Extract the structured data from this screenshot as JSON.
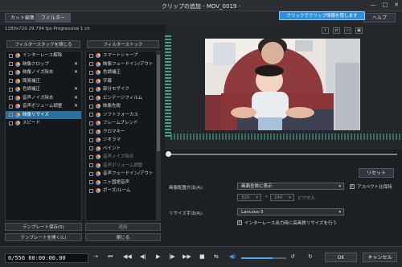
{
  "window": {
    "title": "クリップの追加 - MOV_0019 -",
    "controls": [
      "—",
      "□",
      "✕"
    ]
  },
  "toolbar": {
    "cut_edit": "カット編集",
    "filter": "フィルター",
    "help": "ヘルプ",
    "tooltip": "クリックでクリップ情報を隠します"
  },
  "info": "1280x720 29.794 fps Progressive  1 ch",
  "left": {
    "header_button": "フィルタースタックを閉じる",
    "stack": [
      {
        "label": "インターレース解除",
        "checked": false,
        "removable": false,
        "selected": false
      },
      {
        "label": "映像クロップ",
        "checked": false,
        "removable": true,
        "selected": false
      },
      {
        "label": "映像ノイズ除去",
        "checked": false,
        "removable": true,
        "selected": false
      },
      {
        "label": "簡易補正",
        "checked": false,
        "removable": false,
        "selected": false
      },
      {
        "label": "色調補正",
        "checked": false,
        "removable": true,
        "selected": false
      },
      {
        "label": "音声ノイズ除去",
        "checked": false,
        "removable": true,
        "selected": false
      },
      {
        "label": "音声ボリューム調整",
        "checked": false,
        "removable": true,
        "selected": false
      },
      {
        "label": "映像リサイズ",
        "checked": false,
        "removable": false,
        "selected": true
      },
      {
        "label": "スピード",
        "checked": false,
        "removable": false,
        "selected": false
      }
    ],
    "template_save": "テンプレート保存(S)",
    "template_load": "テンプレートを開く(L)"
  },
  "mid": {
    "header_button": "フィルターストック",
    "items": [
      {
        "label": "スマートシャープ",
        "dim": false
      },
      {
        "label": "映像フェードイン/アウト",
        "dim": false
      },
      {
        "label": "色調補正",
        "dim": false
      },
      {
        "label": "字幕",
        "dim": false
      },
      {
        "label": "部分モザイク",
        "dim": false
      },
      {
        "label": "ビンテージフィルム",
        "dim": false
      },
      {
        "label": "映像先鋭",
        "dim": false
      },
      {
        "label": "ソフトフォーカス",
        "dim": false
      },
      {
        "label": "フレームブレンド",
        "dim": false
      },
      {
        "label": "クロマキー",
        "dim": false
      },
      {
        "label": "ジオラマ",
        "dim": false
      },
      {
        "label": "ペイント",
        "dim": false
      },
      {
        "label": "音声ノイズ除去",
        "dim": true
      },
      {
        "label": "音声ボリューム調整",
        "dim": true
      },
      {
        "label": "音声フェードイン/アウト",
        "dim": false
      },
      {
        "label": "二ヶ国語音声",
        "dim": false
      },
      {
        "label": "ポーズ/ルーム",
        "dim": false
      }
    ],
    "apply": "適用",
    "close": "閉じる"
  },
  "settings": {
    "reset": "リセット",
    "scale_method_label": "画像配置方法(A):",
    "scale_method_value": "画面全体に表示",
    "aspect_label": "アスペクト比保持",
    "aspect_checked": true,
    "width": "320",
    "height": "240",
    "pixel_unit": "ピクセル",
    "resize_method_label": "リサイズ手法(R):",
    "resize_method_value": "Lanczos-3",
    "interlace_label": "インターレース出力時に高画質リサイズを行う",
    "interlace_checked": true
  },
  "transport": {
    "timecode": "0/556  00:00:00.00",
    "volume_percent": 70,
    "ok": "OK",
    "cancel": "キャンセル"
  },
  "colors": {
    "accent": "#2f8fd8",
    "selection": "#2b6f9c",
    "bg": "#1c1f23"
  }
}
